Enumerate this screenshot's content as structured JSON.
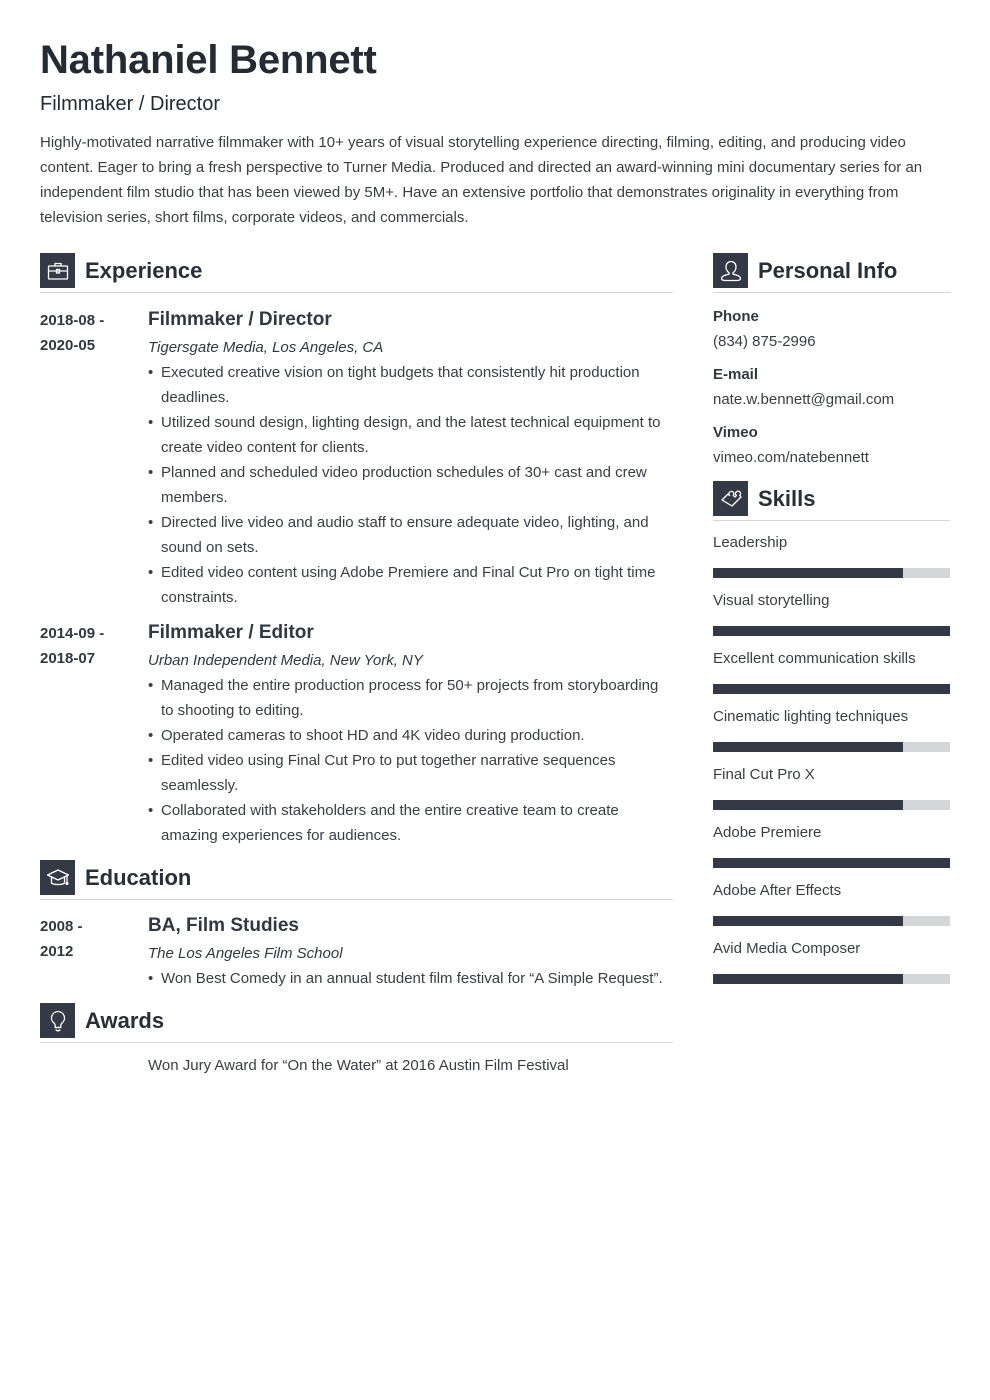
{
  "header": {
    "name": "Nathaniel Bennett",
    "headline": "Filmmaker / Director",
    "summary": "Highly-motivated narrative filmmaker with 10+ years of visual storytelling experience directing, filming, editing, and producing video content. Eager to bring a fresh perspective to Turner Media. Produced and directed an award-winning mini documentary series for an independent film studio that has been viewed by 5M+. Have an extensive portfolio that demonstrates originality in everything from television series, short films, corporate videos, and commercials."
  },
  "experience": {
    "title": "Experience",
    "icon": "briefcase-icon",
    "entries": [
      {
        "date_start": "2018-08 -",
        "date_end": "2020-05",
        "title": "Filmmaker / Director",
        "org": "Tigersgate Media, Los Angeles, CA",
        "bullets": [
          "Executed creative vision on tight budgets that consistently hit production deadlines.",
          "Utilized sound design, lighting design, and the latest technical equipment to create video content for clients.",
          "Planned and scheduled video production schedules of 30+ cast and crew members.",
          "Directed live video and audio staff to ensure adequate video, lighting, and sound on sets.",
          "Edited video content using Adobe Premiere and Final Cut Pro on tight time constraints."
        ]
      },
      {
        "date_start": "2014-09 -",
        "date_end": "2018-07",
        "title": "Filmmaker / Editor",
        "org": "Urban Independent Media, New York, NY",
        "bullets": [
          "Managed the entire production process for 50+ projects from storyboarding to shooting to editing.",
          "Operated cameras to shoot HD and 4K video during production.",
          "Edited video using Final Cut Pro to put together narrative sequences seamlessly.",
          "Collaborated with stakeholders and the entire creative team to create amazing experiences for audiences."
        ]
      }
    ]
  },
  "education": {
    "title": "Education",
    "icon": "graduation-cap-icon",
    "entries": [
      {
        "date_start": "2008 -",
        "date_end": "2012",
        "title": "BA, Film Studies",
        "org": "The Los Angeles Film School",
        "bullets": [
          "Won Best Comedy in an annual student film festival for “A Simple Request”."
        ]
      }
    ]
  },
  "awards": {
    "title": "Awards",
    "icon": "lightbulb-icon",
    "items": [
      "Won Jury Award for “On the Water” at 2016 Austin Film Festival"
    ]
  },
  "personal_info": {
    "title": "Personal Info",
    "icon": "person-icon",
    "fields": [
      {
        "label": "Phone",
        "value": "(834) 875-2996"
      },
      {
        "label": "E-mail",
        "value": "nate.w.bennett@gmail.com"
      },
      {
        "label": "Vimeo",
        "value": "vimeo.com/natebennett"
      }
    ]
  },
  "skills": {
    "title": "Skills",
    "icon": "puzzle-piece-icon",
    "items": [
      {
        "name": "Leadership",
        "level": 0.8
      },
      {
        "name": "Visual storytelling",
        "level": 1.0
      },
      {
        "name": "Excellent communication skills",
        "level": 1.0
      },
      {
        "name": "Cinematic lighting techniques",
        "level": 0.8
      },
      {
        "name": "Final Cut Pro X",
        "level": 0.8
      },
      {
        "name": "Adobe Premiere",
        "level": 1.0
      },
      {
        "name": "Adobe After Effects",
        "level": 0.8
      },
      {
        "name": "Avid Media Composer",
        "level": 0.8
      }
    ]
  },
  "colors": {
    "accent": "#333a46",
    "bar_track": "#d5d6d7",
    "text": "#333740"
  }
}
